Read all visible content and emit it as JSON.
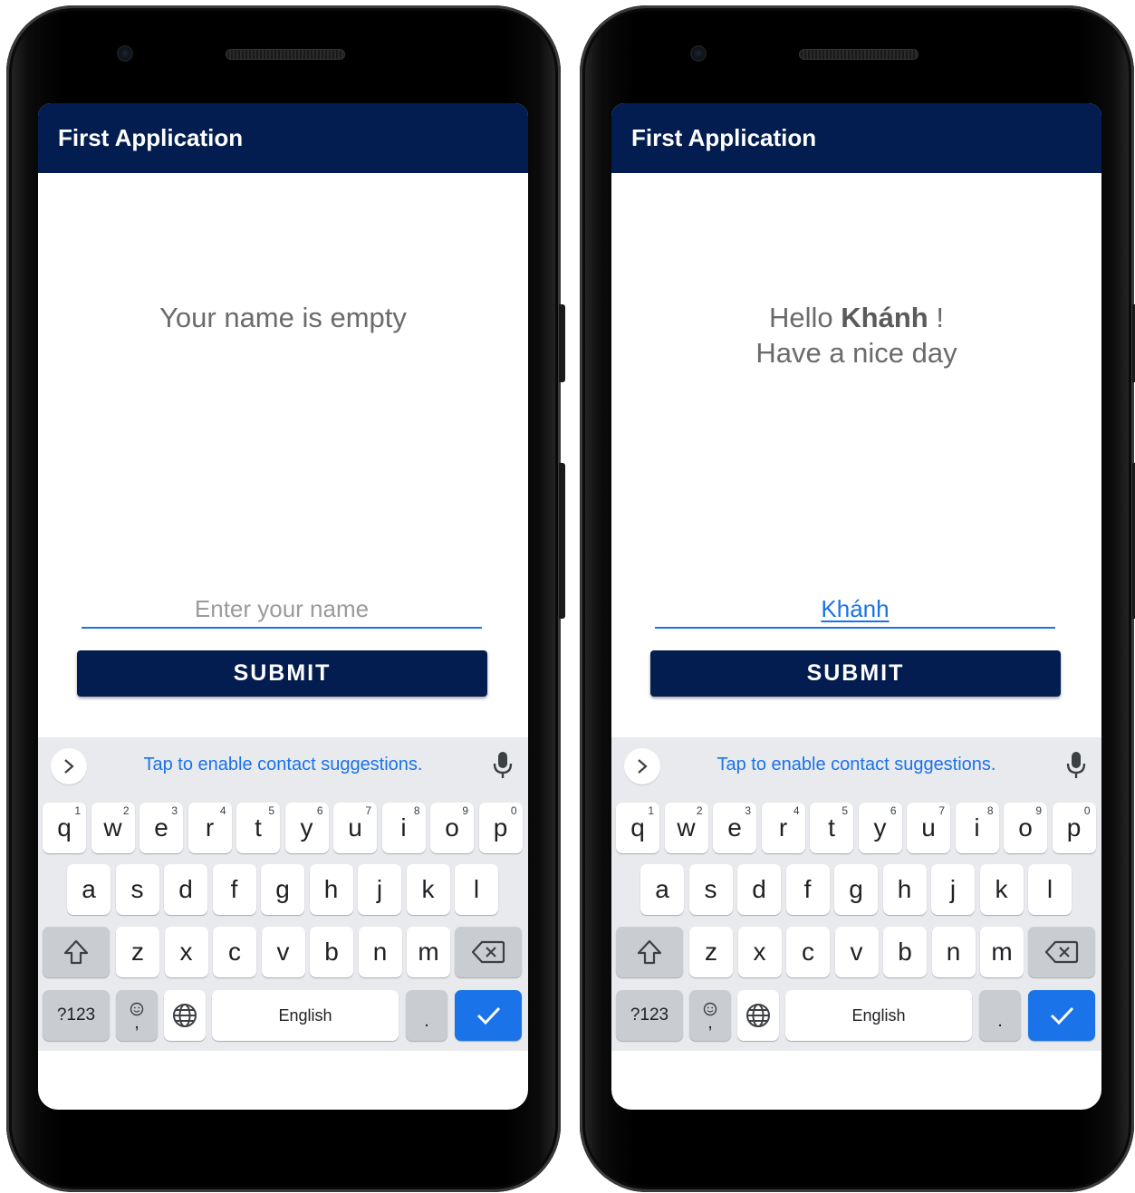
{
  "app": {
    "title": "First Application"
  },
  "screens": {
    "empty": {
      "message": "Your name is empty",
      "name_input": {
        "value": "",
        "placeholder": "Enter your name"
      },
      "submit_label": "SUBMIT"
    },
    "filled": {
      "greeting_prefix": "Hello",
      "greeting_name": "Khánh",
      "greeting_suffix": "!",
      "greeting_line2": "Have a nice day",
      "name_input": {
        "value": "Khánh",
        "placeholder": "Enter your name"
      },
      "submit_label": "SUBMIT"
    }
  },
  "keyboard": {
    "suggestion": "Tap to enable contact suggestions.",
    "row1": [
      {
        "k": "q",
        "n": "1"
      },
      {
        "k": "w",
        "n": "2"
      },
      {
        "k": "e",
        "n": "3"
      },
      {
        "k": "r",
        "n": "4"
      },
      {
        "k": "t",
        "n": "5"
      },
      {
        "k": "y",
        "n": "6"
      },
      {
        "k": "u",
        "n": "7"
      },
      {
        "k": "i",
        "n": "8"
      },
      {
        "k": "o",
        "n": "9"
      },
      {
        "k": "p",
        "n": "0"
      }
    ],
    "row2": [
      "a",
      "s",
      "d",
      "f",
      "g",
      "h",
      "j",
      "k",
      "l"
    ],
    "row3": [
      "z",
      "x",
      "c",
      "v",
      "b",
      "n",
      "m"
    ],
    "symbols_label": "?123",
    "comma_label": ",",
    "space_label": "English",
    "period_label": ".",
    "icons": [
      "chevron-right-icon",
      "microphone-icon",
      "shift-icon",
      "backspace-icon",
      "emoji-icon",
      "globe-icon",
      "checkmark-icon"
    ]
  },
  "colors": {
    "appbar": "#031d50",
    "accent": "#1a73e8",
    "keyboard_bg": "#e8eaed"
  }
}
